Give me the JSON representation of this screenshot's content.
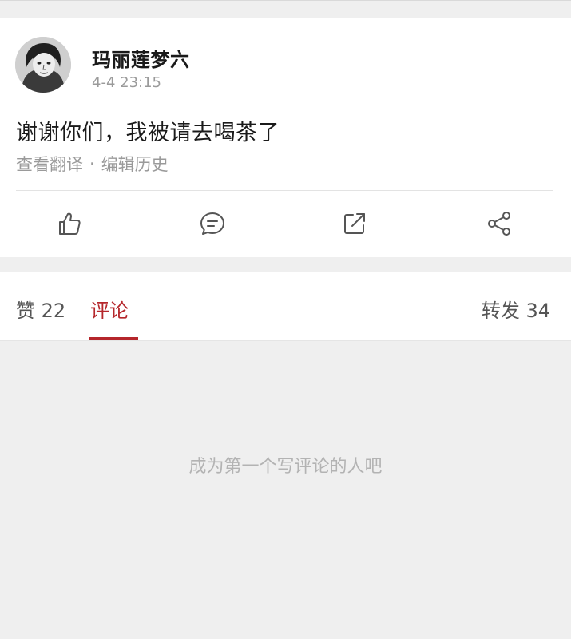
{
  "post": {
    "author": "玛丽莲梦六",
    "time": "4-4 23:15",
    "text": "谢谢你们，我被请去喝茶了",
    "translate_link": "查看翻译",
    "separator": "·",
    "edit_history_link": "编辑历史"
  },
  "actions": [
    {
      "name": "like",
      "icon": "thumbs-up-icon"
    },
    {
      "name": "comment",
      "icon": "comment-bubble-icon"
    },
    {
      "name": "repost",
      "icon": "repost-arrow-icon"
    },
    {
      "name": "share",
      "icon": "share-icon"
    }
  ],
  "tabs": {
    "likes": "赞 22",
    "comments": "评论",
    "reposts": "转发 34",
    "active": "comments"
  },
  "comments": {
    "empty_message": "成为第一个写评论的人吧"
  },
  "colors": {
    "accent": "#b5262b",
    "muted_text": "#9a9a9a",
    "background": "#efefef"
  }
}
